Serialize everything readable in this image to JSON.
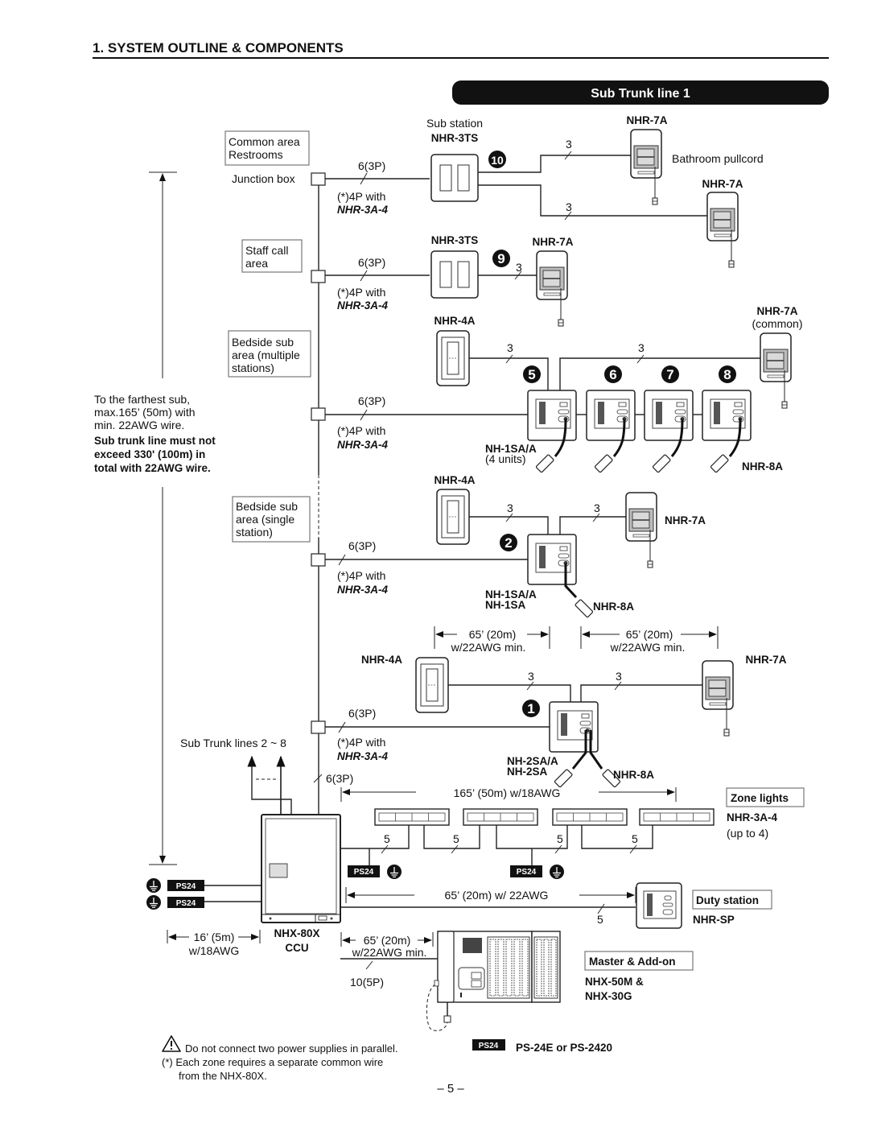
{
  "header": {
    "title": "1. SYSTEM OUTLINE & COMPONENTS",
    "banner": "Sub Trunk line 1"
  },
  "areas": {
    "common": [
      "Common area",
      "Restrooms"
    ],
    "staff": [
      "Staff call",
      "area"
    ],
    "bedside_multi": [
      "Bedside sub",
      "area (multiple",
      "stations)"
    ],
    "bedside_single": [
      "Bedside sub",
      "area (single",
      "station)"
    ]
  },
  "junction_box_label": "Junction box",
  "wire": {
    "six3p": "6(3P)",
    "fourp_with": "(*)4P with",
    "nhr3a4": "NHR-3A-4",
    "three": "3",
    "five": "5",
    "ten5p": "10(5P)"
  },
  "stations": {
    "sub_station_label": "Sub station",
    "nhr3ts": "NHR-3TS",
    "nhr7a": "NHR-7A",
    "nhr7a_common": "(common)",
    "bathroom_pullcord": "Bathroom pullcord",
    "nhr4a": "NHR-4A",
    "nh1sa_a": "NH-1SA/A",
    "four_units": "(4 units)",
    "nh1sa": "NH-1SA",
    "nh2sa_a": "NH-2SA/A",
    "nh2sa": "NH-2SA",
    "nhr8a": "NHR-8A"
  },
  "numbers": [
    "10",
    "9",
    "5",
    "6",
    "7",
    "8",
    "2",
    "1"
  ],
  "notes": {
    "farthest": [
      "To the farthest sub,",
      "max.165’ (50m) with",
      "min. 22AWG wire."
    ],
    "must_not": [
      "Sub trunk line must not",
      "exceed 330' (100m) in",
      "total with 22AWG wire."
    ],
    "sub_trunk_lines": "Sub Trunk lines 2 ~ 8"
  },
  "dimensions": {
    "d65_20m": "65’ (20m)",
    "w22awg_min": "w/22AWG  min.",
    "d165": "165’ (50m) w/18AWG",
    "d65_duty": "65’ (20m) w/ 22AWG",
    "d16": "16’ (5m)",
    "w18awg": "w/18AWG",
    "d65_master": "65’ (20m)",
    "w22awg_min2": "w/22AWG min."
  },
  "zone_lights": {
    "label": "Zone lights",
    "model": "NHR-3A-4",
    "qty": "(up to 4)"
  },
  "ccu": {
    "model": "NHX-80X",
    "label": "CCU"
  },
  "duty_station": {
    "label": "Duty station",
    "model": "NHR-SP"
  },
  "master": {
    "label": "Master & Add-on",
    "model1": "NHX-50M &",
    "model2": "NHX-30G"
  },
  "power": {
    "badge": "PS24",
    "legend": "PS-24E or PS-2420"
  },
  "footer": {
    "warning": "Do not connect two power supplies in parallel.",
    "note1": "(*) Each zone requires a separate common wire",
    "note2": "from the NHX-80X.",
    "page": "– 5 –"
  }
}
